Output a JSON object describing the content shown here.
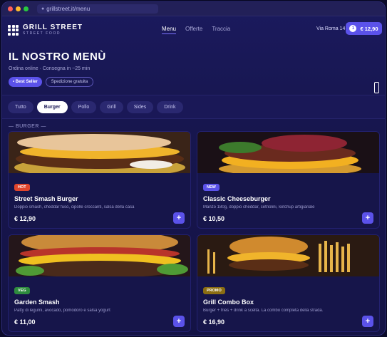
{
  "browser": {
    "url": "grillstreet.it/menu"
  },
  "header": {
    "brand_name": "GRILL STREET",
    "brand_tag": "STREET FOOD",
    "nav": [
      {
        "label": "Menu",
        "active": true
      },
      {
        "label": "Offerte",
        "active": false
      },
      {
        "label": "Traccia",
        "active": false
      }
    ],
    "location": "Via Roma 14",
    "cart": {
      "count": "1",
      "total": "€ 12,90"
    }
  },
  "hero": {
    "title": "IL NOSTRO MENÙ",
    "subtitle": "Ordina online · Consegna in ~25 min",
    "badges": [
      "• Best Seller",
      "Spedizione gratuita"
    ]
  },
  "tabs": [
    "Tutto",
    "Burger",
    "Pollo",
    "Grill",
    "Sides",
    "Drink"
  ],
  "active_tab": "Burger",
  "section_label": "— BURGER —",
  "products": [
    {
      "tag": "HOT",
      "tag_color": "#e0452d",
      "name": "Street Smash Burger",
      "desc": "Doppio smash, cheddar fuso, cipolle croccanti, salsa della casa",
      "price": "€ 12,90"
    },
    {
      "tag": "NEW",
      "tag_color": "#5b52ea",
      "name": "Classic Cheeseburger",
      "desc": "Manzo 180g, doppio cheddar, cetriolini, ketchup artigianale",
      "price": "€ 10,50"
    },
    {
      "tag": "VEG",
      "tag_color": "#2e8b3e",
      "name": "Garden Smash",
      "desc": "Patty di legumi, avocado, pomodoro e salsa yogurt",
      "price": "€ 11,00"
    },
    {
      "tag": "PROMO",
      "tag_color": "#8a6d12",
      "name": "Grill Combo Box",
      "desc": "Burger + fries + drink a scelta. La combo completa della strada.",
      "price": "€ 16,90"
    }
  ],
  "colors": {
    "accent": "#5b52ea",
    "background": "#17164f"
  }
}
